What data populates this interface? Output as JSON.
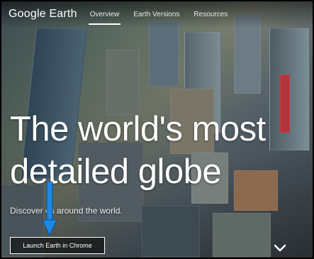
{
  "nav": {
    "logo": "Google Earth",
    "tabs": [
      {
        "label": "Overview",
        "active": true
      },
      {
        "label": "Earth Versions",
        "active": false
      },
      {
        "label": "Resources",
        "active": false
      }
    ]
  },
  "hero": {
    "headline_line1": "The world's most",
    "headline_line2": "detailed globe",
    "subtext": "Discover      es around the world.",
    "cta_label": "Launch Earth in Chrome"
  },
  "colors": {
    "accent": "#1e88e5",
    "text": "#ffffff"
  }
}
